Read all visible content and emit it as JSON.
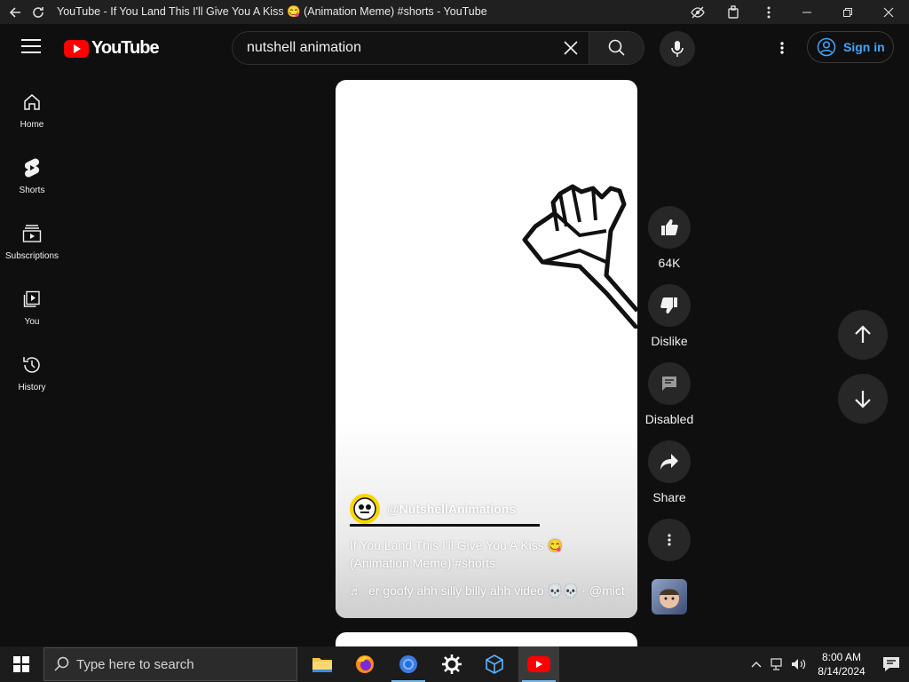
{
  "browser": {
    "title": "YouTube - If You Land This I'll Give You A Kiss 😋 (Animation Meme) #shorts - YouTube",
    "back_icon": "back-arrow-icon",
    "reload_icon": "reload-icon"
  },
  "header": {
    "logo_text": "YouTube",
    "search": {
      "value": "nutshell animation",
      "placeholder": "Search"
    },
    "signin_label": "Sign in"
  },
  "sidebar": {
    "items": [
      {
        "label": "Home",
        "icon": "home-icon"
      },
      {
        "label": "Shorts",
        "icon": "shorts-icon"
      },
      {
        "label": "Subscriptions",
        "icon": "subscriptions-icon"
      },
      {
        "label": "You",
        "icon": "you-icon"
      },
      {
        "label": "History",
        "icon": "history-icon"
      }
    ]
  },
  "short": {
    "channel": "@NutshellAnimations",
    "title": "If You Land This I'll Give You A Kiss 😋 (Animation Meme) #shorts",
    "music": "er goofy ahh silly billy ahh video 💀💀 · @mict"
  },
  "actions": {
    "like_count": "64K",
    "dislike_label": "Dislike",
    "comments_label": "Disabled",
    "share_label": "Share"
  },
  "taskbar": {
    "search_placeholder": "Type here to search",
    "time": "8:00 AM",
    "date": "8/14/2024"
  },
  "colors": {
    "background": "#0f0f0f",
    "youtube_red": "#ff0000",
    "link_blue": "#3ea6ff",
    "button_gray": "#272727"
  }
}
